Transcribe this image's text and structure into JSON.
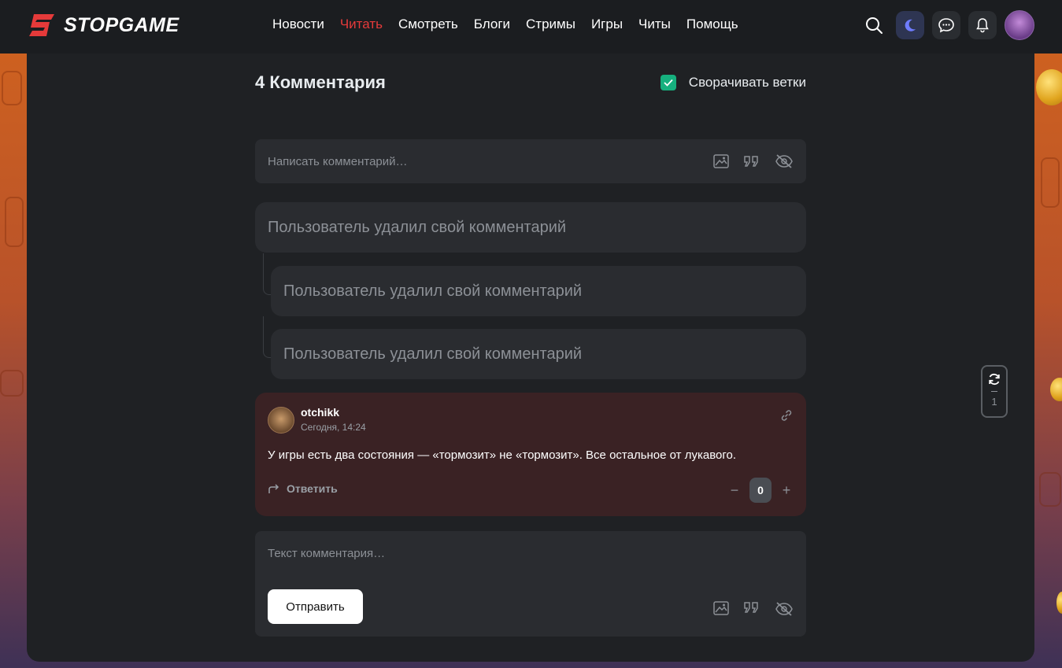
{
  "header": {
    "logo_text": "STOPGAME",
    "nav": [
      {
        "label": "Новости",
        "active": false
      },
      {
        "label": "Читать",
        "active": true
      },
      {
        "label": "Смотреть",
        "active": false
      },
      {
        "label": "Блоги",
        "active": false
      },
      {
        "label": "Стримы",
        "active": false
      },
      {
        "label": "Игры",
        "active": false
      },
      {
        "label": "Читы",
        "active": false
      },
      {
        "label": "Помощь",
        "active": false
      }
    ],
    "icons": [
      "search-icon",
      "moon-icon",
      "chat-icon",
      "bell-icon",
      "avatar"
    ]
  },
  "comments_section": {
    "title": "4 Комментария",
    "collapse_label": "Сворачивать ветки",
    "collapse_checked": true,
    "input_placeholder": "Написать комментарий…",
    "deleted_text": [
      "Пользователь удалил свой комментарий",
      "Пользователь удалил свой комментарий",
      "Пользователь удалил свой комментарий"
    ],
    "comment": {
      "author": "otchikk",
      "time": "Сегодня, 14:24",
      "text": "У игры есть два состояния — «тормозит» не «тормозит». Все остальное от лукавого.",
      "reply_label": "Ответить",
      "score": "0",
      "minus": "−",
      "plus": "+"
    },
    "compose": {
      "placeholder": "Текст комментария…",
      "send_label": "Отправить"
    }
  },
  "refresh_widget": {
    "count": "1"
  },
  "colors": {
    "accent_red": "#e53a3a",
    "check_green": "#16b07e",
    "panel_bg": "#1f2124",
    "highlight_comment_bg": "#3a2224"
  }
}
